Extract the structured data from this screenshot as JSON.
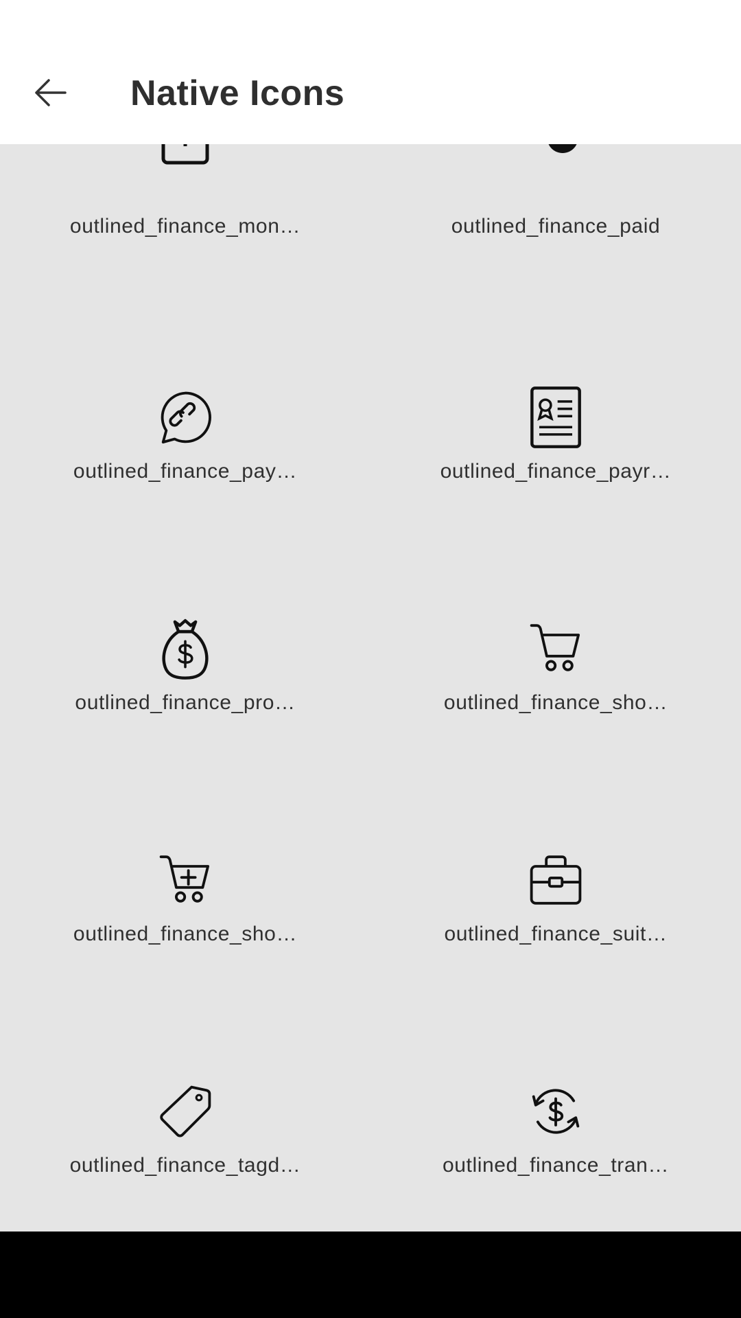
{
  "header": {
    "title": "Native Icons",
    "back_icon": "arrow-left-icon"
  },
  "icons": [
    {
      "label": "outlined_finance_mon…",
      "icon": "money-box-icon"
    },
    {
      "label": "outlined_finance_paid",
      "icon": "paid-icon"
    },
    {
      "label": "outlined_finance_pay…",
      "icon": "payment-link-chat-icon"
    },
    {
      "label": "outlined_finance_payr…",
      "icon": "payroll-document-icon"
    },
    {
      "label": "outlined_finance_pro…",
      "icon": "money-bag-icon"
    },
    {
      "label": "outlined_finance_sho…",
      "icon": "shopping-cart-icon"
    },
    {
      "label": "outlined_finance_sho…",
      "icon": "shopping-cart-add-icon"
    },
    {
      "label": "outlined_finance_suit…",
      "icon": "suitcase-icon"
    },
    {
      "label": "outlined_finance_tagd…",
      "icon": "price-tag-icon"
    },
    {
      "label": "outlined_finance_tran…",
      "icon": "transfer-dollar-icon"
    }
  ]
}
